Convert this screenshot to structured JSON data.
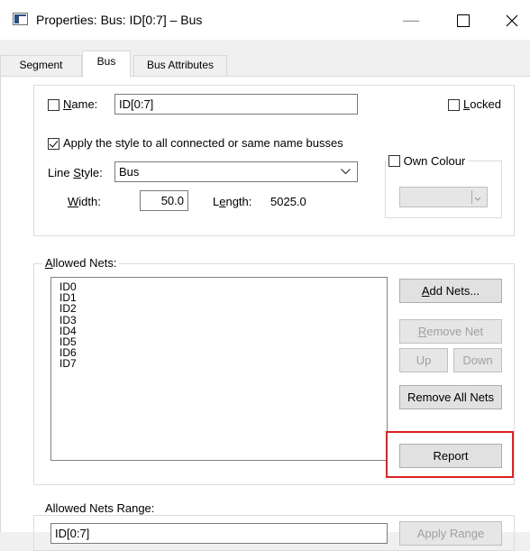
{
  "window": {
    "title": "Properties: Bus: ID[0:7] – Bus",
    "minimize": "—",
    "maximize": "☐",
    "close": "✕"
  },
  "tabs": [
    {
      "label": "Segment",
      "active": false
    },
    {
      "label": "Bus",
      "active": true
    },
    {
      "label": "Bus Attributes",
      "active": false
    }
  ],
  "general": {
    "name_label": "Name:",
    "name_value": "ID[0:7]",
    "name_checked": false,
    "locked_label": "Locked",
    "locked_checked": false,
    "apply_style_label": "Apply the style to all connected or same name busses",
    "apply_style_checked": true,
    "line_style_label": "Line Style:",
    "line_style_value": "Bus",
    "width_label": "Width:",
    "width_value": "50.0",
    "length_label": "Length:",
    "length_value": "5025.0",
    "own_colour_label": "Own Colour",
    "own_colour_checked": false
  },
  "allowed_nets": {
    "legend": "Allowed Nets:",
    "items": [
      "ID0",
      "ID1",
      "ID2",
      "ID3",
      "ID4",
      "ID5",
      "ID6",
      "ID7"
    ],
    "add_nets": "Add Nets...",
    "remove_net": "Remove Net",
    "up": "Up",
    "down": "Down",
    "remove_all": "Remove All Nets",
    "report": "Report"
  },
  "allowed_nets_range": {
    "legend": "Allowed Nets Range:",
    "value": "ID[0:7]",
    "apply_range": "Apply Range"
  },
  "colors": {
    "highlight": "#dd2222",
    "disabled_text": "#a0a0a0"
  }
}
